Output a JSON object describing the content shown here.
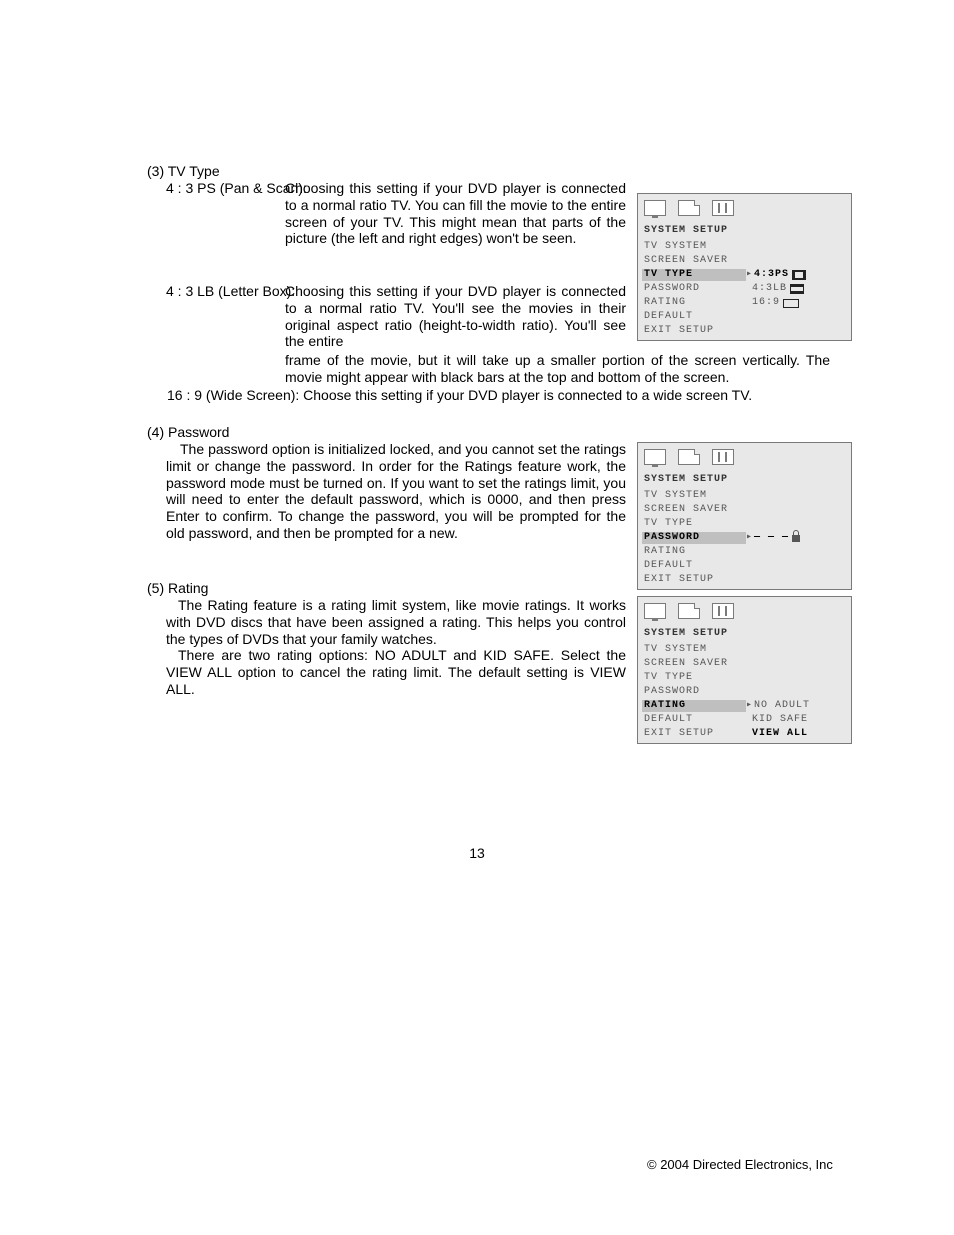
{
  "section3": {
    "header": "(3) TV Type",
    "item1_label": "4 : 3 PS (Pan & Scan):",
    "item1_body": "Choosing this setting if your DVD player is connected to a normal ratio TV. You can fill the movie to the entire screen of your TV. This might mean that parts of the picture (the left and right edges) won't be seen.",
    "item2_label": "4 : 3 LB (Letter Box):",
    "item2_body_a": "Choosing this setting if your DVD player is connected to a normal ratio TV. You'll see the movies in their original aspect ratio (height-to-width ratio). You'll see the entire",
    "item2_body_b": "frame of the movie, but it will take up a smaller portion of the screen vertically. The movie might appear with black bars at the top and bottom of the screen.",
    "item3": "16 : 9 (Wide Screen): Choose this setting if your DVD player is connected to a wide screen TV."
  },
  "section4": {
    "header": "(4) Password",
    "body": "The password option is initialized locked, and you cannot set the ratings limit or change the password. In order for the Ratings feature work, the password mode must be turned on. If you want to set the ratings limit, you will need to enter the default password, which is 0000, and then press Enter to confirm. To change the password, you will be prompted for the old password, and then be prompted for a new."
  },
  "section5": {
    "header": "(5) Rating",
    "p1": "The Rating feature is a rating limit system, like movie ratings. It works with DVD discs that have been assigned a rating. This helps you control the types of DVDs that your family watches.",
    "p2": "There are two rating options: NO ADULT and KID SAFE. Select the VIEW ALL option to cancel the rating limit. The default setting is VIEW ALL."
  },
  "page_number": "13",
  "footer": "© 2004 Directed Electronics, Inc",
  "osd_common": {
    "title": "SYSTEM SETUP",
    "menu": {
      "tv_system": "TV SYSTEM",
      "screen_saver": "SCREEN SAVER",
      "tv_type": "TV TYPE",
      "password": "PASSWORD",
      "rating": "RATING",
      "default": "DEFAULT",
      "exit": "EXIT SETUP"
    }
  },
  "osd1": {
    "arrow": "▸",
    "opt1": "4:3PS",
    "opt2": "4:3LB",
    "opt3": "16:9"
  },
  "osd2": {
    "arrow": "▸",
    "val": "— — —"
  },
  "osd3": {
    "arrow": "▸",
    "opt1": "NO ADULT",
    "opt2": "KID SAFE",
    "opt3": "VIEW ALL"
  }
}
